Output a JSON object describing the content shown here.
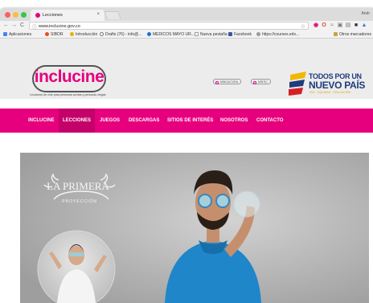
{
  "browser": {
    "tab_title": "Lecciones",
    "tab_close": "×",
    "profile": "Andr",
    "nav": {
      "back": "←",
      "forward": "→",
      "reload": "C",
      "info": "ⓘ",
      "star": "☆"
    },
    "url": "www.inclucine.gov.co",
    "bookmarks": [
      {
        "label": "Aplicaciones",
        "color": "#4285f4"
      },
      {
        "label": "SIBOR",
        "color": "#e44d26"
      },
      {
        "label": "Introducción",
        "color": "#e8b100"
      },
      {
        "label": "Drafts (76) - info@...",
        "color": "#777777"
      },
      {
        "label": "MEDICOS MAYO UR...",
        "color": "#1f6fd1"
      },
      {
        "label": "Nueva pestaña",
        "color": "#bbbbbb"
      },
      {
        "label": "Facebook",
        "color": "#3b5998"
      },
      {
        "label": "https://courses.edx...",
        "color": "#9a9a9a"
      }
    ],
    "other_bookmarks": "Otros marcadores"
  },
  "site": {
    "logo": "inclucine",
    "tagline": "Lecciones de cine para personas sordas y personas ciegas",
    "header_links": [
      "MINCULTURA",
      "MINTIC"
    ],
    "gov_logo": {
      "line1": "TODOS POR UN",
      "line2": "NUEVO PAÍS",
      "line3": "PAZ · EQUIDAD · EDUCACIÓN"
    },
    "menu": [
      "INCLUCINE",
      "LECCIONES",
      "JUEGOS",
      "DESCARGAS",
      "SITIOS DE INTERÉS",
      "NOSOTROS",
      "CONTACTO"
    ],
    "active_menu": "LECCIONES",
    "video": {
      "title_line": "LA PRIMERA",
      "subtitle_line": "PROYECCIÓN"
    }
  },
  "colors": {
    "brand": "#e6007e",
    "menu_active": "#c4006a",
    "gov_blue": "#1f3b7c",
    "gov_yellow": "#e0a900"
  }
}
